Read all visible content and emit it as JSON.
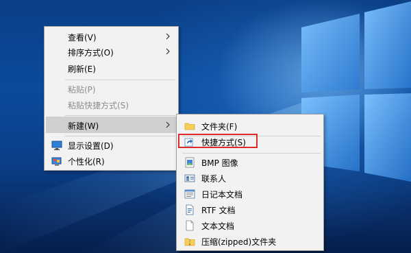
{
  "context_menu": {
    "items": [
      {
        "label": "查看(V)",
        "has_submenu": true
      },
      {
        "label": "排序方式(O)",
        "has_submenu": true
      },
      {
        "label": "刷新(E)"
      },
      {
        "label": "粘贴(P)",
        "disabled": true
      },
      {
        "label": "粘贴快捷方式(S)",
        "disabled": true
      },
      {
        "label": "新建(W)",
        "has_submenu": true,
        "highlighted": true
      },
      {
        "label": "显示设置(D)",
        "icon": "display-settings-icon"
      },
      {
        "label": "个性化(R)",
        "icon": "personalize-icon"
      }
    ]
  },
  "new_submenu": {
    "items": [
      {
        "label": "文件夹(F)",
        "icon": "folder-icon"
      },
      {
        "label": "快捷方式(S)",
        "icon": "shortcut-icon",
        "emphasized": true
      },
      {
        "label": "BMP 图像",
        "icon": "bmp-image-icon"
      },
      {
        "label": "联系人",
        "icon": "contact-icon"
      },
      {
        "label": "日记本文档",
        "icon": "journal-document-icon"
      },
      {
        "label": "RTF 文档",
        "icon": "rtf-document-icon"
      },
      {
        "label": "文本文档",
        "icon": "text-document-icon"
      },
      {
        "label": "压缩(zipped)文件夹",
        "icon": "zip-folder-icon"
      }
    ]
  },
  "colors": {
    "menu_bg": "#f2f2f2",
    "hover_bg": "#cfcfcf",
    "disabled_text": "#8c8c8c",
    "annotation_box": "#e02828"
  }
}
